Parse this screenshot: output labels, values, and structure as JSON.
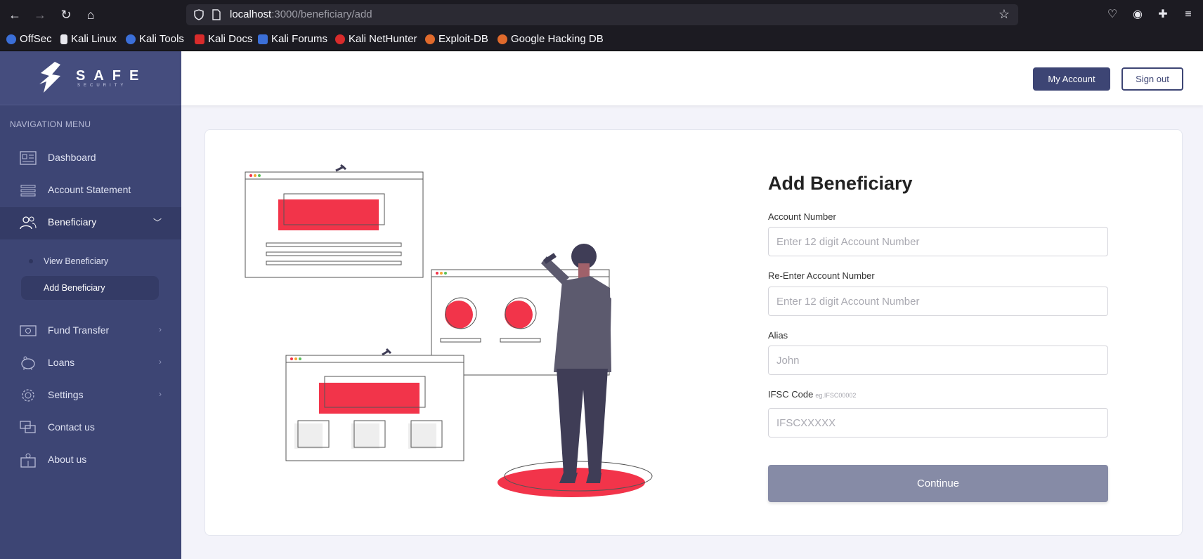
{
  "browser": {
    "url_host": "localhost",
    "url_rest": ":3000/beneficiary/add",
    "bookmarks": [
      "OffSec",
      "Kali Linux",
      "Kali Tools",
      "Kali Docs",
      "Kali Forums",
      "Kali NetHunter",
      "Exploit-DB",
      "Google Hacking DB"
    ]
  },
  "brand": {
    "name": "SAFE",
    "tagline": "SECURITY"
  },
  "sidebar": {
    "section_label": "NAVIGATION MENU",
    "items": [
      {
        "label": "Dashboard",
        "icon": "dashboard-icon"
      },
      {
        "label": "Account Statement",
        "icon": "statement-icon"
      },
      {
        "label": "Beneficiary",
        "icon": "users-icon",
        "expanded": true
      },
      {
        "label": "Fund Transfer",
        "icon": "money-icon"
      },
      {
        "label": "Loans",
        "icon": "piggy-bank-icon"
      },
      {
        "label": "Settings",
        "icon": "gear-icon"
      },
      {
        "label": "Contact us",
        "icon": "chat-icon"
      },
      {
        "label": "About us",
        "icon": "info-icon"
      }
    ],
    "beneficiary_sub": [
      {
        "label": "View Beneficiary"
      },
      {
        "label": "Add Beneficiary",
        "active": true
      }
    ]
  },
  "header": {
    "my_account": "My Account",
    "sign_out": "Sign out"
  },
  "form": {
    "title": "Add Beneficiary",
    "account_number": {
      "label": "Account Number",
      "placeholder": "Enter 12 digit Account Number"
    },
    "re_account_number": {
      "label": "Re-Enter Account Number",
      "placeholder": "Enter 12 digit Account Number"
    },
    "alias": {
      "label": "Alias",
      "placeholder": "John"
    },
    "ifsc": {
      "label": "IFSC Code",
      "hint": "eg.IFSC00002",
      "placeholder": "IFSCXXXXX"
    },
    "continue": "Continue"
  },
  "colors": {
    "sidebar": "#3d4574",
    "accent_red": "#f2344a",
    "button_muted": "#868ba6"
  }
}
